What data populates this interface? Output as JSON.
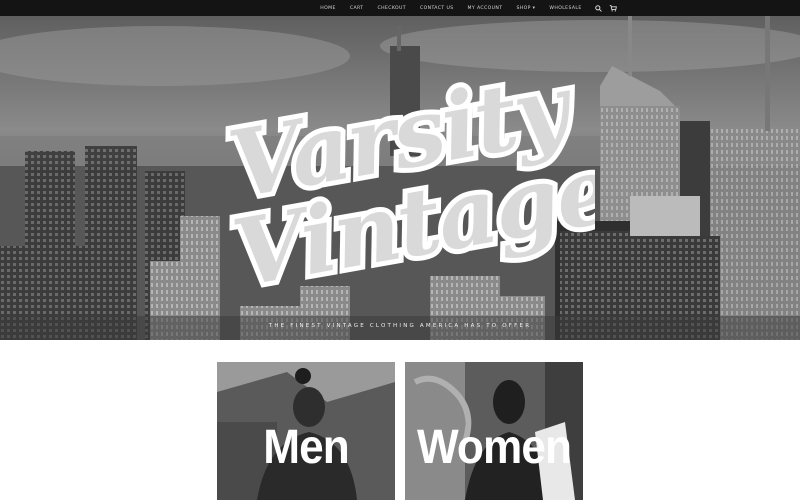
{
  "nav": {
    "items": [
      "HOME",
      "CART",
      "CHECKOUT",
      "CONTACT US",
      "MY ACCOUNT",
      "SHOP ▾",
      "WHOLESALE"
    ],
    "icons": [
      "search-icon",
      "cart-icon"
    ]
  },
  "hero": {
    "logo_line1": "Varsity",
    "logo_line2": "Vintage",
    "tagline": "THE FINEST VINTAGE CLOTHING AMERICA HAS TO OFFER"
  },
  "categories": [
    {
      "label": "Men"
    },
    {
      "label": "Women"
    }
  ],
  "colors": {
    "nav_bg": "#141414",
    "logo_fill": "#d9d9d9",
    "logo_outline": "#ffffff"
  }
}
